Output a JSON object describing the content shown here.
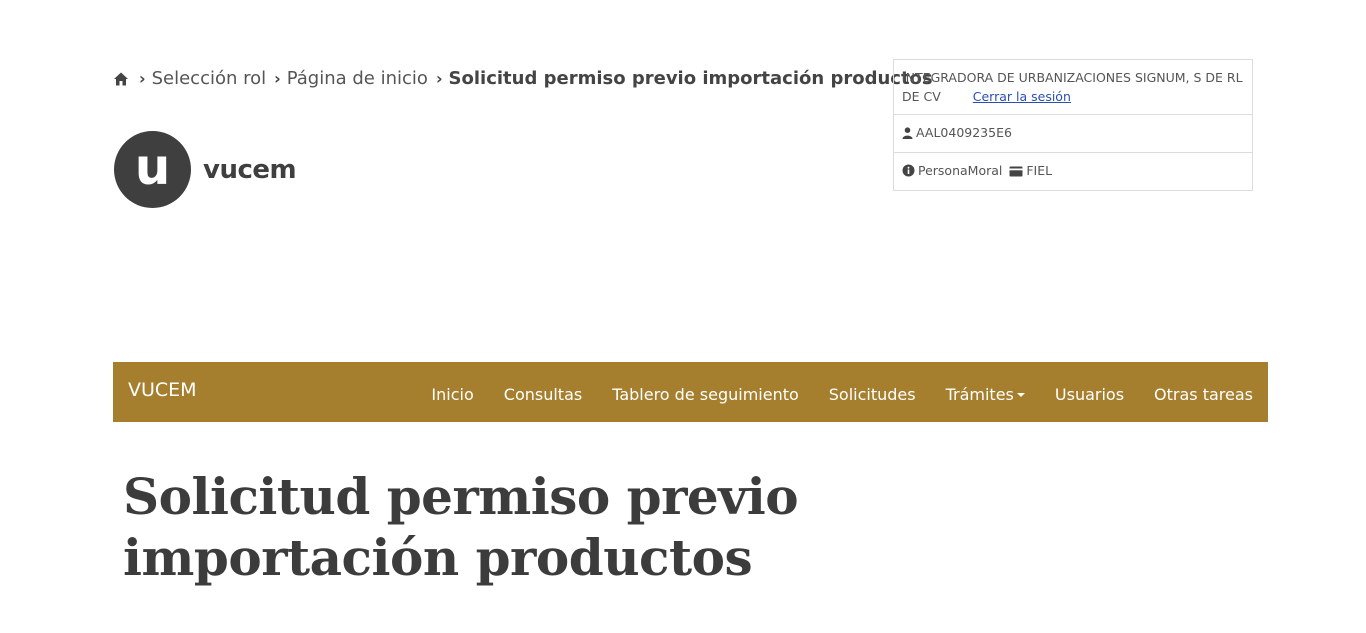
{
  "breadcrumb": {
    "items": [
      "Selección rol",
      "Página de inicio"
    ],
    "current": "Solicitud permiso previo importación productos"
  },
  "logo": {
    "mark": "u",
    "text": "vucem"
  },
  "user_panel": {
    "company": "INTEGRADORA DE URBANIZACIONES SIGNUM, S DE RL DE CV",
    "logout_label": "Cerrar la sesión",
    "user_id": "AAL0409235E6",
    "person_type": "PersonaMoral",
    "auth_type": "FIEL"
  },
  "navbar": {
    "brand": "VUCEM",
    "items": [
      "Inicio",
      "Consultas",
      "Tablero de seguimiento",
      "Solicitudes",
      "Trámites",
      "Usuarios",
      "Otras tareas"
    ]
  },
  "page": {
    "title": "Solicitud permiso previo importación productos"
  },
  "colors": {
    "navbar_bg": "#a57f2e",
    "logo_bg": "#3f3f3f",
    "link": "#2a4fb0"
  }
}
